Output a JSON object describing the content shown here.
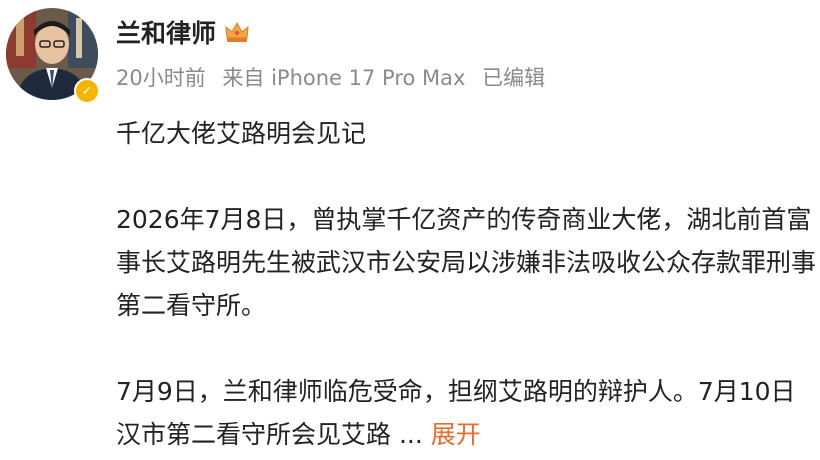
{
  "post": {
    "author": "兰和律师",
    "badge_icon": "crown-icon",
    "meta": {
      "time": "20小时前",
      "source": "来自 iPhone 17 Pro Max",
      "edited": "已编辑"
    },
    "lines": [
      "千亿大佬艾路明会见记",
      "2026年7月8日，曾执掌千亿资产的传奇商业大佬，湖北前首富",
      "事长艾路明先生被武汉市公安局以涉嫌非法吸收公众存款罪刑事",
      "第二看守所。",
      "7月9日，兰和律师临危受命，担纲艾路明的辩护人。7月10日",
      "汉市第二看守所会见艾路"
    ],
    "ellipsis": "...",
    "expand_label": "展开"
  },
  "colors": {
    "accent": "#e86c2c",
    "verified": "#f6b400",
    "meta_text": "#8a8a8a"
  }
}
